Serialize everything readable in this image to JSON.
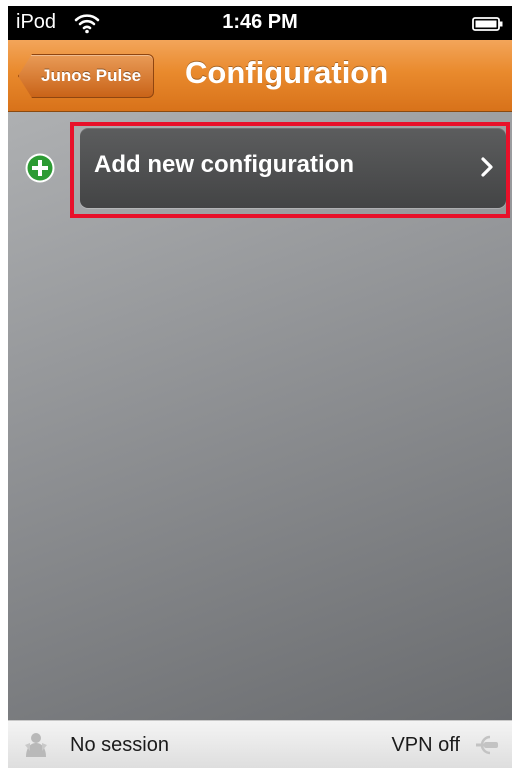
{
  "status_bar": {
    "carrier": "iPod",
    "time": "1:46 PM",
    "wifi_icon": "wifi-icon",
    "battery_icon": "battery-icon"
  },
  "nav_bar": {
    "back_label": "Junos Pulse",
    "title": "Configuration",
    "accent_color": "#e98a2d"
  },
  "content": {
    "add_icon": "plus-circle-icon",
    "row_label": "Add new configuration",
    "chevron_icon": "chevron-right-icon",
    "highlight_color": "#e8102a"
  },
  "session_bar": {
    "session_icon": "session-status-icon",
    "session_status": "No session",
    "vpn_status": "VPN off",
    "vpn_icon": "vpn-plug-icon"
  }
}
